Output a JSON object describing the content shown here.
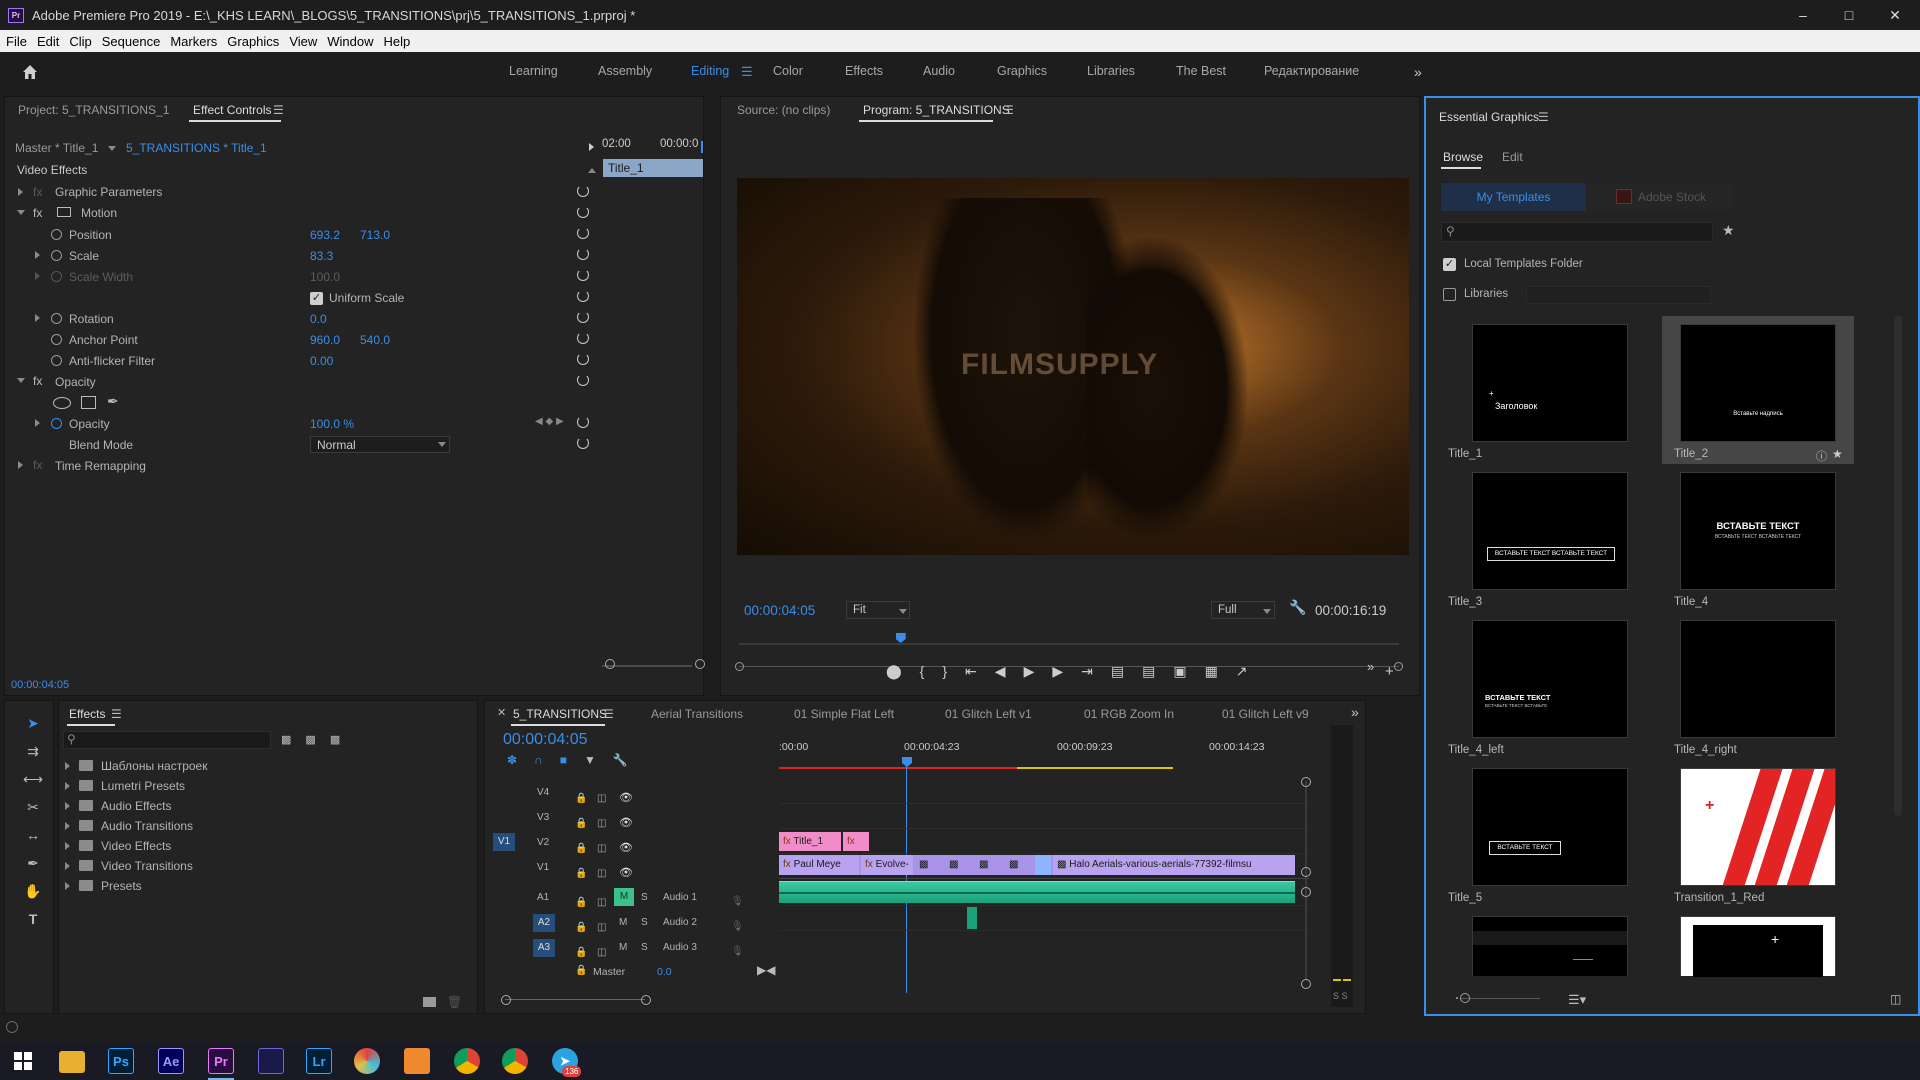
{
  "window": {
    "title": "Adobe Premiere Pro 2019 - E:\\_KHS LEARN\\_BLOGS\\5_TRANSITIONS\\prj\\5_TRANSITIONS_1.prproj *",
    "logo_text": "Pr"
  },
  "menu": [
    "File",
    "Edit",
    "Clip",
    "Sequence",
    "Markers",
    "Graphics",
    "View",
    "Window",
    "Help"
  ],
  "workspaces": {
    "items": [
      "Learning",
      "Assembly",
      "Editing",
      "Color",
      "Effects",
      "Audio",
      "Graphics",
      "Libraries",
      "The Best",
      "Редактирование"
    ],
    "active": "Editing"
  },
  "effect_controls": {
    "tabs": [
      "Project: 5_TRANSITIONS_1",
      "Effect Controls"
    ],
    "master": "Master * Title_1",
    "sequence": "5_TRANSITIONS * Title_1",
    "time_start": "02:00",
    "time_end": "00:00:0",
    "clip_label": "Title_1",
    "section": "Video Effects",
    "graphic_parameters": "Graphic Parameters",
    "motion": "Motion",
    "position_label": "Position",
    "position_x": "693.2",
    "position_y": "713.0",
    "scale_label": "Scale",
    "scale_value": "83.3",
    "scale_width_label": "Scale Width",
    "scale_width_value": "100.0",
    "uniform_scale": "Uniform Scale",
    "rotation_label": "Rotation",
    "rotation_value": "0.0",
    "anchor_label": "Anchor Point",
    "anchor_x": "960.0",
    "anchor_y": "540.0",
    "antiflicker_label": "Anti-flicker Filter",
    "antiflicker_value": "0.00",
    "opacity_section": "Opacity",
    "opacity_label": "Opacity",
    "opacity_value": "100.0 %",
    "blend_label": "Blend Mode",
    "blend_value": "Normal",
    "time_remap": "Time Remapping",
    "timecode": "00:00:04:05"
  },
  "program": {
    "source_tab": "Source: (no clips)",
    "program_tab": "Program: 5_TRANSITIONS",
    "watermark": "FILMSUPPLY",
    "timecode": "00:00:04:05",
    "fit": "Fit",
    "quality": "Full",
    "duration": "00:00:16:19",
    "playhead_fraction": 0.245
  },
  "essential_graphics": {
    "title": "Essential Graphics",
    "tabs": [
      "Browse",
      "Edit"
    ],
    "sources": [
      "My Templates",
      "Adobe Stock"
    ],
    "local_templates": "Local Templates Folder",
    "libraries": "Libraries",
    "templates": [
      {
        "name": "Title_1",
        "preview": "Заголовок"
      },
      {
        "name": "Title_2",
        "preview": "Вставьте надпись"
      },
      {
        "name": "Title_3",
        "preview": "ВСТАВЬТЕ ТЕКСТ ВСТАВЬТЕ ТЕКСТ"
      },
      {
        "name": "Title_4",
        "preview": "ВСТАВЬТЕ ТЕКСТ",
        "preview_sub": "ВСТАВЬТЕ ТЕКСТ ВСТАВЬТЕ ТЕКСТ"
      },
      {
        "name": "Title_4_left",
        "preview": "ВСТАВЬТЕ ТЕКСТ",
        "preview_sub": "ВСТАВЬТЕ ТЕКСТ ВСТАВЬТЕ"
      },
      {
        "name": "Title_4_right",
        "preview": ""
      },
      {
        "name": "Title_5",
        "preview": "ВСТАВЬТЕ ТЕКСТ"
      },
      {
        "name": "Transition_1_Red",
        "preview": ""
      }
    ]
  },
  "effects_panel": {
    "title": "Effects",
    "folders": [
      "Шаблоны настроек",
      "Lumetri Presets",
      "Audio Effects",
      "Audio Transitions",
      "Video Effects",
      "Video Transitions",
      "Presets"
    ]
  },
  "timeline": {
    "tabs": [
      "5_TRANSITIONS",
      "Aerial Transitions",
      "01 Simple Flat Left",
      "01 Glitch Left v1",
      "01 RGB Zoom In",
      "01 Glitch Left v9"
    ],
    "timecode": "00:00:04:05",
    "ruler": [
      ":00:00",
      "00:00:04:23",
      "00:00:09:23",
      "00:00:14:23"
    ],
    "tracks": [
      {
        "id": "V4",
        "name": ""
      },
      {
        "id": "V3",
        "name": ""
      },
      {
        "id": "V2",
        "name": ""
      },
      {
        "id": "V1",
        "name": ""
      },
      {
        "id": "A1",
        "name": "Audio 1"
      },
      {
        "id": "A2",
        "name": "Audio 2"
      },
      {
        "id": "A3",
        "name": "Audio 3"
      }
    ],
    "master_label": "Master",
    "master_value": "0.0",
    "clips": {
      "title": "Title_1",
      "v1_a": "Paul Meye",
      "v1_b": "Evolve-",
      "v1_c": "Halo Aerials-various-aerials-77392-filmsu"
    },
    "source_patch": "V1",
    "mute": "M",
    "solo": "S"
  },
  "taskbar": {
    "apps": [
      "Ps",
      "Ae",
      "Pr",
      "Lr"
    ],
    "badge": "136"
  }
}
